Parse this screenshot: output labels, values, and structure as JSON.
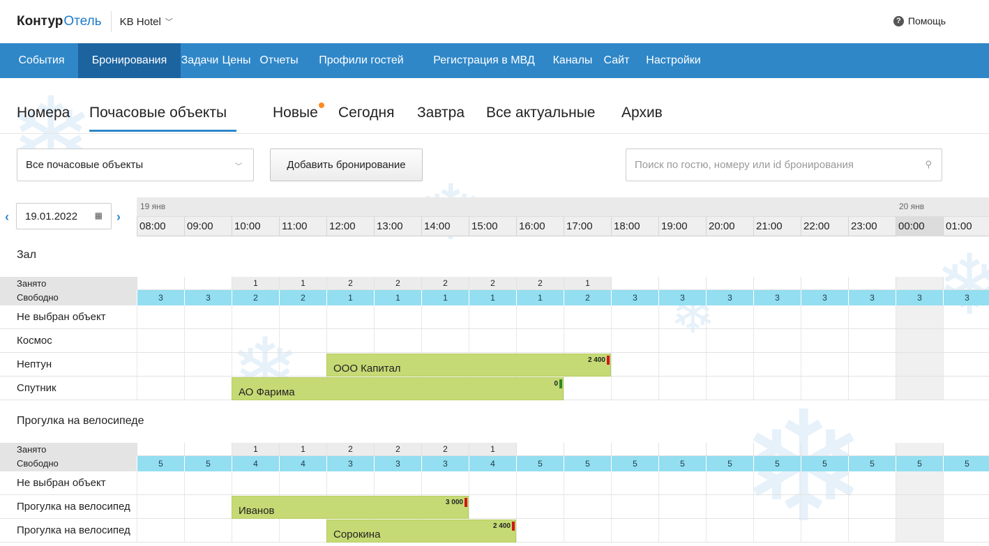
{
  "app": {
    "logo_primary": "Контур",
    "logo_secondary": "Отель",
    "hotel_name": "KB Hotel",
    "help_label": "Помощь"
  },
  "nav": {
    "items": [
      {
        "label": "События",
        "active": false
      },
      {
        "label": "Бронирования",
        "active": true
      },
      {
        "label": "Задачи",
        "active": false
      },
      {
        "label": "Цены",
        "active": false
      },
      {
        "label": "Отчеты",
        "active": false
      },
      {
        "label": "Профили гостей",
        "active": false
      },
      {
        "label": "Регистрация в МВД",
        "active": false
      },
      {
        "label": "Каналы",
        "active": false
      },
      {
        "label": "Сайт",
        "active": false
      },
      {
        "label": "Настройки",
        "active": false
      }
    ]
  },
  "subtabs": {
    "items": [
      {
        "label": "Номера",
        "active": false
      },
      {
        "label": "Почасовые объекты",
        "active": true
      },
      {
        "label": "Новые",
        "active": false,
        "has_dot": true
      },
      {
        "label": "Сегодня",
        "active": false
      },
      {
        "label": "Завтра",
        "active": false
      },
      {
        "label": "Все актуальные",
        "active": false
      },
      {
        "label": "Архив",
        "active": false
      }
    ]
  },
  "toolbar": {
    "filter_value": "Все почасовые объекты",
    "add_booking_label": "Добавить бронирование",
    "search_placeholder": "Поиск по гостю, номеру или id бронирования"
  },
  "calendar": {
    "date": "19.01.2022",
    "day_labels": [
      "19 янв",
      "20 янв"
    ],
    "hours": [
      "08:00",
      "09:00",
      "10:00",
      "11:00",
      "12:00",
      "13:00",
      "14:00",
      "15:00",
      "16:00",
      "17:00",
      "18:00",
      "19:00",
      "20:00",
      "21:00",
      "22:00",
      "23:00",
      "00:00",
      "01:00"
    ]
  },
  "sections": [
    {
      "title": "Зал",
      "busy_label": "Занято",
      "free_label": "Свободно",
      "busy": [
        "",
        "",
        "1",
        "1",
        "2",
        "2",
        "2",
        "2",
        "2",
        "1",
        "",
        "",
        "",
        "",
        "",
        "",
        "",
        ""
      ],
      "free": [
        "3",
        "3",
        "2",
        "2",
        "1",
        "1",
        "1",
        "1",
        "1",
        "2",
        "3",
        "3",
        "3",
        "3",
        "3",
        "3",
        "3",
        "3"
      ],
      "objects": [
        {
          "name": "Не выбран объект"
        },
        {
          "name": "Космос"
        },
        {
          "name": "Нептун"
        },
        {
          "name": "Спутник"
        }
      ],
      "bookings": [
        {
          "object": "Нептун",
          "guest": "ООО Капитал",
          "price": "2 400",
          "start_hour": "12:00",
          "end_hour": "18:00",
          "status_color": "#d0161a"
        },
        {
          "object": "Спутник",
          "guest": "АО Фарима",
          "price": "0",
          "start_hour": "10:00",
          "end_hour": "17:00",
          "status_color": "#2d8a1f"
        }
      ]
    },
    {
      "title": "Прогулка на велосипеде",
      "busy_label": "Занято",
      "free_label": "Свободно",
      "busy": [
        "",
        "",
        "1",
        "1",
        "2",
        "2",
        "2",
        "1",
        "",
        "",
        "",
        "",
        "",
        "",
        "",
        "",
        "",
        ""
      ],
      "free": [
        "5",
        "5",
        "4",
        "4",
        "3",
        "3",
        "3",
        "4",
        "5",
        "5",
        "5",
        "5",
        "5",
        "5",
        "5",
        "5",
        "5",
        "5"
      ],
      "objects": [
        {
          "name": "Не выбран объект"
        },
        {
          "name": "Прогулка на велосипед"
        },
        {
          "name": "Прогулка на велосипед"
        }
      ],
      "bookings": [
        {
          "object": "Прогулка на велосипед",
          "row_index": 1,
          "guest": "Иванов",
          "price": "3 000",
          "start_hour": "10:00",
          "end_hour": "15:00",
          "status_color": "#d0161a"
        },
        {
          "object": "Прогулка на велосипед",
          "row_index": 2,
          "guest": "Сорокина",
          "price": "2 400",
          "start_hour": "12:00",
          "end_hour": "16:00",
          "status_color": "#d0161a"
        }
      ]
    }
  ]
}
